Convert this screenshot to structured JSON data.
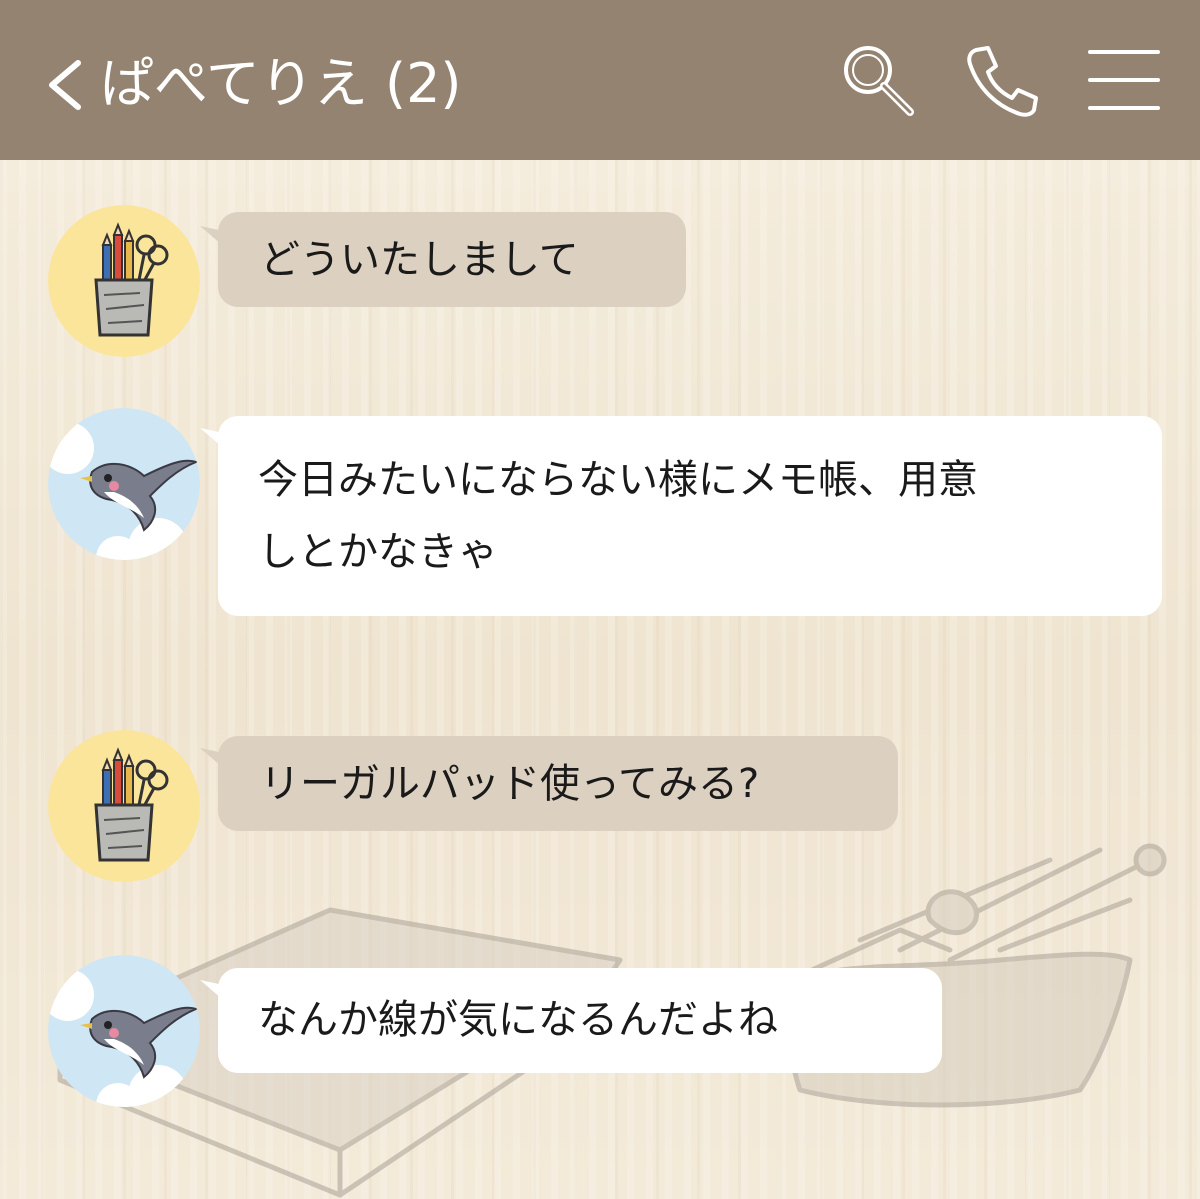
{
  "header": {
    "back_symbol": "く",
    "title": "ぱぺてりえ (2)",
    "icons": [
      "back-icon",
      "search-icon",
      "phone-icon",
      "menu-icon"
    ]
  },
  "messages": [
    {
      "sender": "pencil-cup",
      "text": "どういたしまして",
      "bubble_color": "#dcd0c0"
    },
    {
      "sender": "swallow",
      "text_line1": "今日みたいにならない様にメモ帳、用意",
      "text_line2": "しとかなきゃ",
      "bubble_color": "#ffffff"
    },
    {
      "sender": "pencil-cup",
      "text": "リーガルパッド使ってみる?",
      "bubble_color": "#dcd0c0"
    },
    {
      "sender": "swallow",
      "text": "なんか線が気になるんだよね",
      "bubble_color": "#ffffff"
    }
  ],
  "colors": {
    "header_bg": "#958372",
    "background": "#f3ead9",
    "avatar_yellow": "#fbe59a",
    "avatar_blue": "#cfe6f5"
  }
}
